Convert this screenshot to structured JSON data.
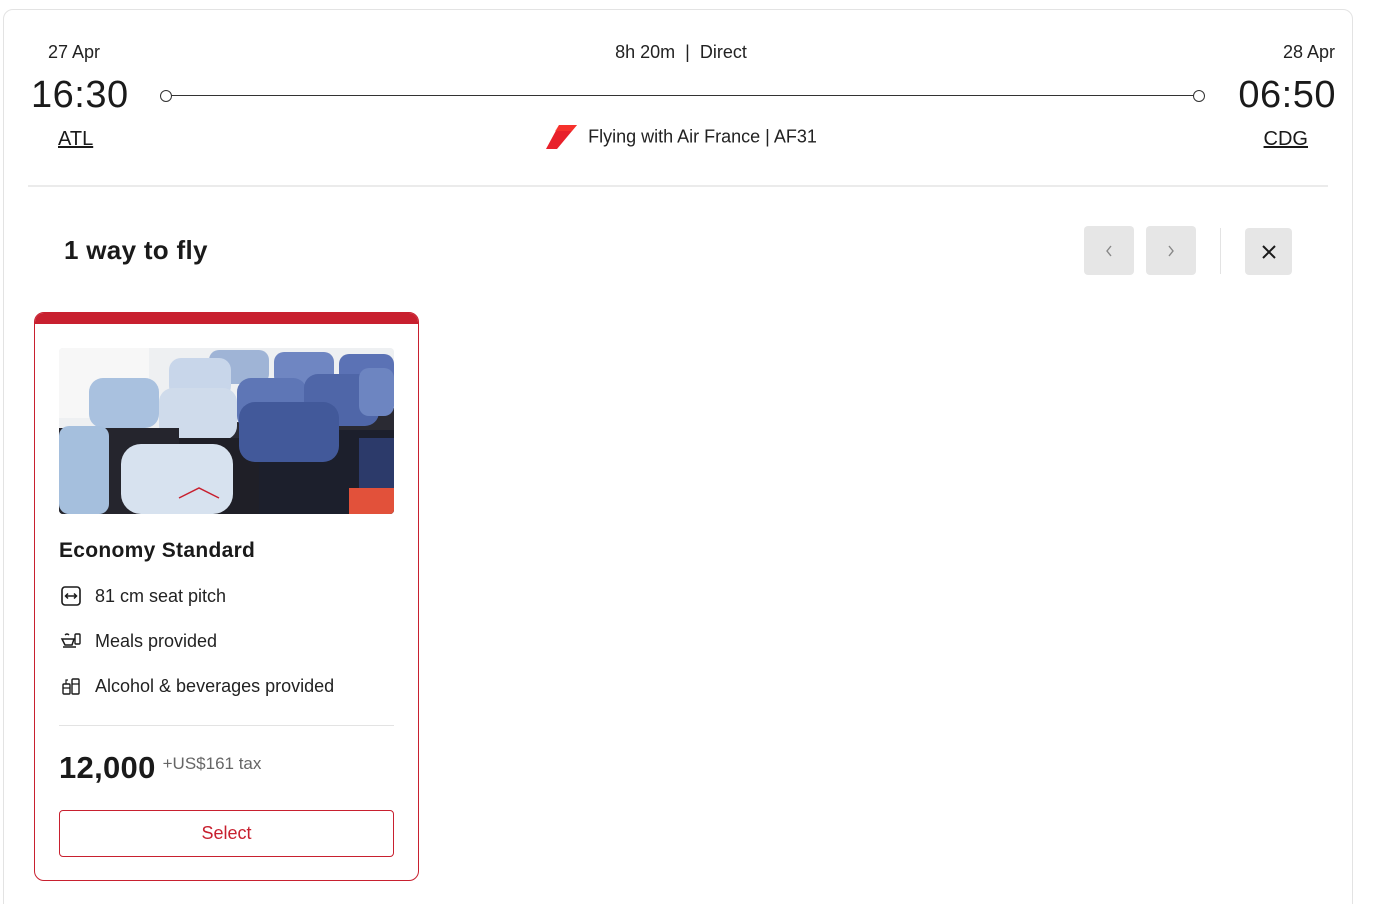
{
  "flight": {
    "departure": {
      "date": "27 Apr",
      "time": "16:30",
      "code": "ATL"
    },
    "arrival": {
      "date": "28 Apr",
      "time": "06:50",
      "code": "CDG"
    },
    "duration": "8h 20m",
    "separator": "|",
    "stops": "Direct",
    "carrier_text": "Flying with Air France | AF31",
    "carrier_logo_icon": "air-france-logo-icon"
  },
  "options": {
    "title": "1 way to fly",
    "prev_icon": "chevron-left-icon",
    "next_icon": "chevron-right-icon",
    "close_icon": "close-icon"
  },
  "fare_card": {
    "cabin_name": "Economy Standard",
    "image_icon": "cabin-seats-image",
    "features": [
      {
        "icon": "seat-pitch-icon",
        "label": "81 cm seat pitch"
      },
      {
        "icon": "meal-icon",
        "label": "Meals provided"
      },
      {
        "icon": "beverage-icon",
        "label": "Alcohol & beverages provided"
      }
    ],
    "price_miles": "12,000",
    "price_tax": "+US$161 tax",
    "select_label": "Select"
  },
  "colors": {
    "accent": "#c8202f",
    "button_bg": "#e6e6e6",
    "divider": "#ebebeb"
  }
}
